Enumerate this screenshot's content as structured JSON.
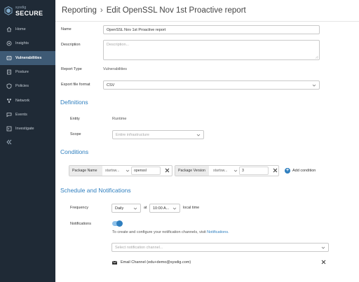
{
  "brand": {
    "small": "sysdig",
    "big": "SECURE"
  },
  "sidebar": {
    "items": [
      {
        "label": "Home",
        "icon": "home-icon",
        "active": false
      },
      {
        "label": "Insights",
        "icon": "insights-icon",
        "active": false
      },
      {
        "label": "Vulnerabilities",
        "icon": "vulnerabilities-icon",
        "active": true
      },
      {
        "label": "Posture",
        "icon": "posture-icon",
        "active": false
      },
      {
        "label": "Policies",
        "icon": "shield-icon",
        "active": false
      },
      {
        "label": "Network",
        "icon": "network-icon",
        "active": false
      },
      {
        "label": "Events",
        "icon": "events-icon",
        "active": false
      },
      {
        "label": "Investigate",
        "icon": "investigate-icon",
        "active": false
      }
    ],
    "collapse_icon": "double-chevron-left-icon"
  },
  "header": {
    "breadcrumb_root": "Reporting",
    "separator": "›",
    "title": "Edit OpenSSL Nov 1st Proactive report"
  },
  "form": {
    "name_label": "Name",
    "name_value": "OpenSSL Nov 1st Proactive report",
    "description_label": "Description",
    "description_placeholder": "Description...",
    "report_type_label": "Report Type",
    "report_type_value": "Vulnerabilities",
    "export_label": "Export file format",
    "export_value": "CSV"
  },
  "definitions": {
    "title": "Definitions",
    "entity_label": "Entity",
    "entity_value": "Runtime",
    "scope_label": "Scope",
    "scope_placeholder": "Entire infrastructure"
  },
  "conditions": {
    "title": "Conditions",
    "items": [
      {
        "field": "Package Name",
        "operator": "startsw...",
        "value": "openssl"
      },
      {
        "field": "Package Version",
        "operator": "startsw...",
        "value": "3"
      }
    ],
    "add_label": "Add condition"
  },
  "schedule": {
    "title": "Schedule and Notifications",
    "frequency_label": "Frequency",
    "frequency_value": "Daily",
    "at_label": "at",
    "time_value": "10:00 A...",
    "timezone_label": "local time",
    "notifications_label": "Notifications",
    "notifications_enabled": true,
    "help_text": "To create and configure your notification channels, visit",
    "help_link": "Notifications.",
    "channel_placeholder": "Select notification channel...",
    "channel_item": "Email Channel (edu+demo@sysdig.com)"
  },
  "colors": {
    "sidebar_bg": "#1f2a36",
    "active_nav": "#3e5a75",
    "accent": "#2f7fbf"
  }
}
